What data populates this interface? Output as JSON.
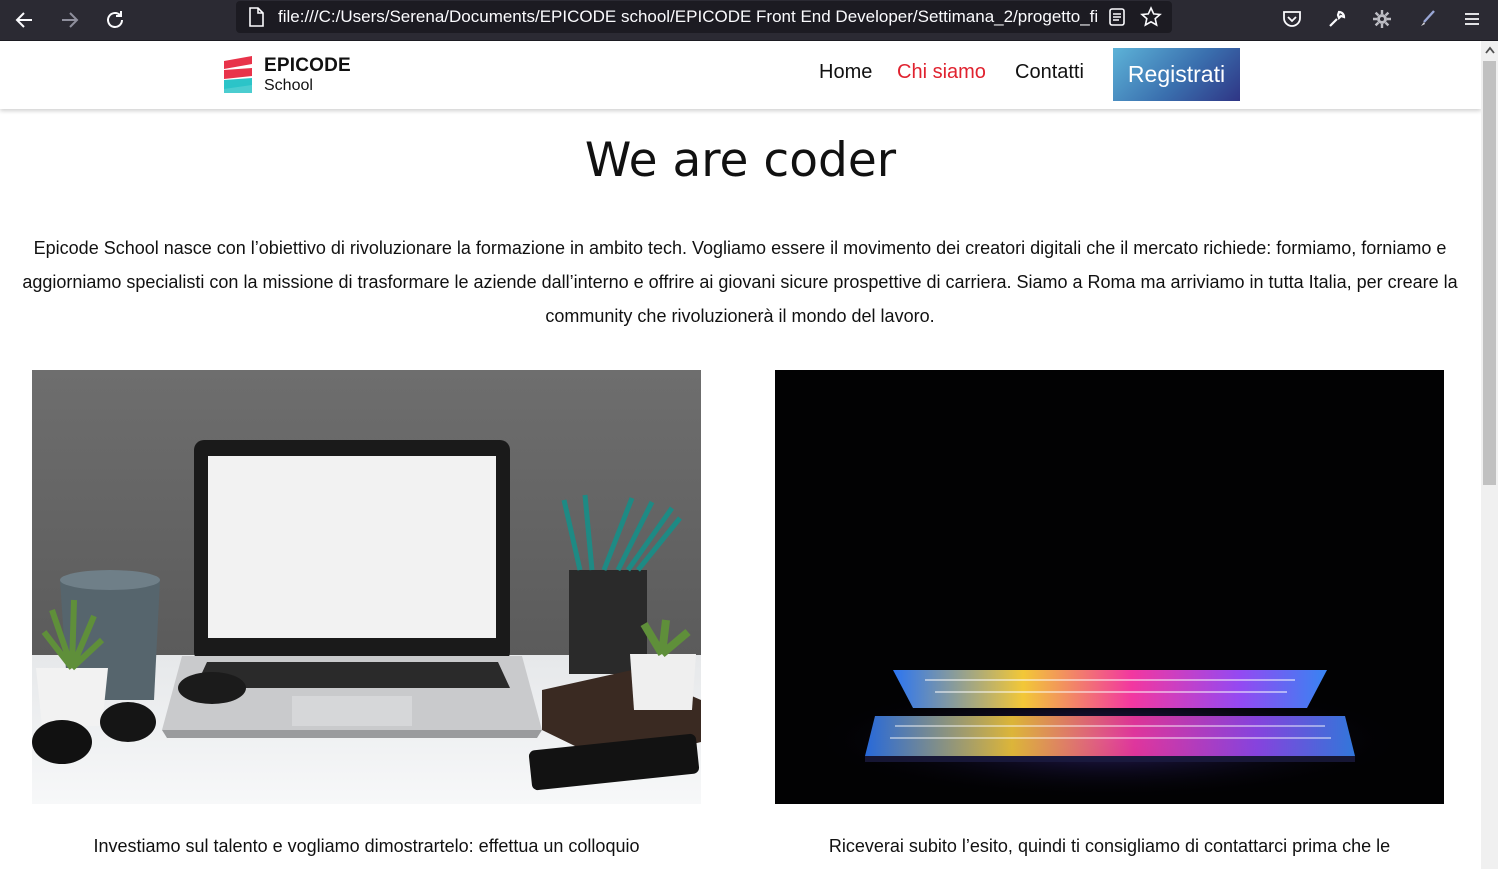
{
  "browser": {
    "url": "file:///C:/Users/Serena/Documents/EPICODE school/EPICODE Front End Developer/Settimana_2/progetto_fir"
  },
  "header": {
    "logo_word": "EPICODE",
    "logo_sub": "School",
    "nav": [
      {
        "label": "Home"
      },
      {
        "label": "Chi siamo"
      },
      {
        "label": "Contatti"
      }
    ],
    "register_label": "Registrati"
  },
  "main": {
    "title": "We are coder",
    "intro": "Epicode School nasce con l’obiettivo di rivoluzionare la formazione in ambito tech. Vogliamo essere il movimento dei creatori digitali che il mercato richiede: formiamo, forniamo e aggiorniamo specialisti con la missione di trasformare le aziende dall’interno e offrire ai giovani sicure prospettive di carriera. Siamo a Roma ma arriviamo in tutta Italia, per creare la community che rivoluzionerà il mondo del lavoro.",
    "cards": [
      {
        "caption": "Investiamo sul talento e vogliamo dimostrartelo: effettua un colloquio"
      },
      {
        "caption": "Riceverai subito l’esito, quindi ti consigliamo di contattarci prima che le"
      }
    ]
  },
  "colors": {
    "accent_red": "#e0222f",
    "register_gradient_start": "#5db3d8",
    "register_gradient_end": "#2f3585",
    "browser_bar": "#2b2a33"
  }
}
